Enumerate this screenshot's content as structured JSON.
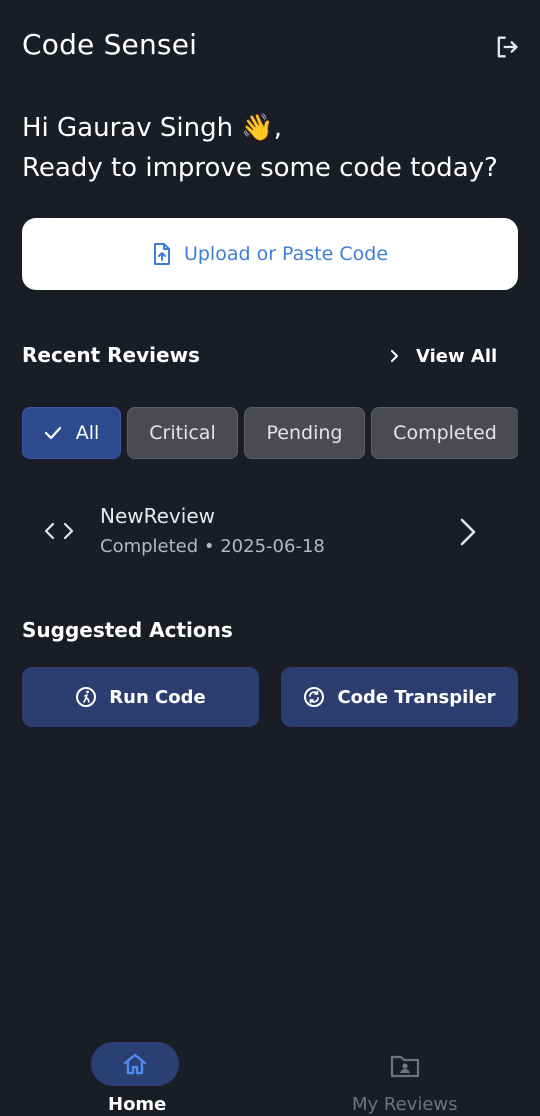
{
  "app": {
    "title": "Code Sensei"
  },
  "header": {
    "logout_icon": "logout-icon"
  },
  "greeting": {
    "line1": "Hi Gaurav Singh 👋,",
    "line2": "Ready to improve some code today?"
  },
  "upload": {
    "label": "Upload or Paste Code",
    "icon": "file-upload-icon"
  },
  "recent": {
    "title": "Recent Reviews",
    "view_all": "View All",
    "filters": [
      {
        "label": "All",
        "selected": true
      },
      {
        "label": "Critical",
        "selected": false
      },
      {
        "label": "Pending",
        "selected": false
      },
      {
        "label": "Completed",
        "selected": false
      }
    ],
    "reviews": [
      {
        "name": "NewReview",
        "meta": "Completed • 2025-06-18"
      }
    ]
  },
  "suggested": {
    "title": "Suggested Actions",
    "actions": [
      {
        "label": "Run Code",
        "icon": "run-icon"
      },
      {
        "label": "Code Transpiler",
        "icon": "sync-icon"
      }
    ]
  },
  "nav": {
    "items": [
      {
        "label": "Home",
        "icon": "home-icon",
        "active": true
      },
      {
        "label": "My Reviews",
        "icon": "folder-user-icon",
        "active": false
      }
    ]
  },
  "colors": {
    "background": "#1a1d26",
    "accent": "#3f7ed8",
    "chip_active": "#2e4a8e",
    "action_button": "#2c3e70",
    "nav_active": "#4f8cf0",
    "nav_inactive": "#6f7380"
  }
}
